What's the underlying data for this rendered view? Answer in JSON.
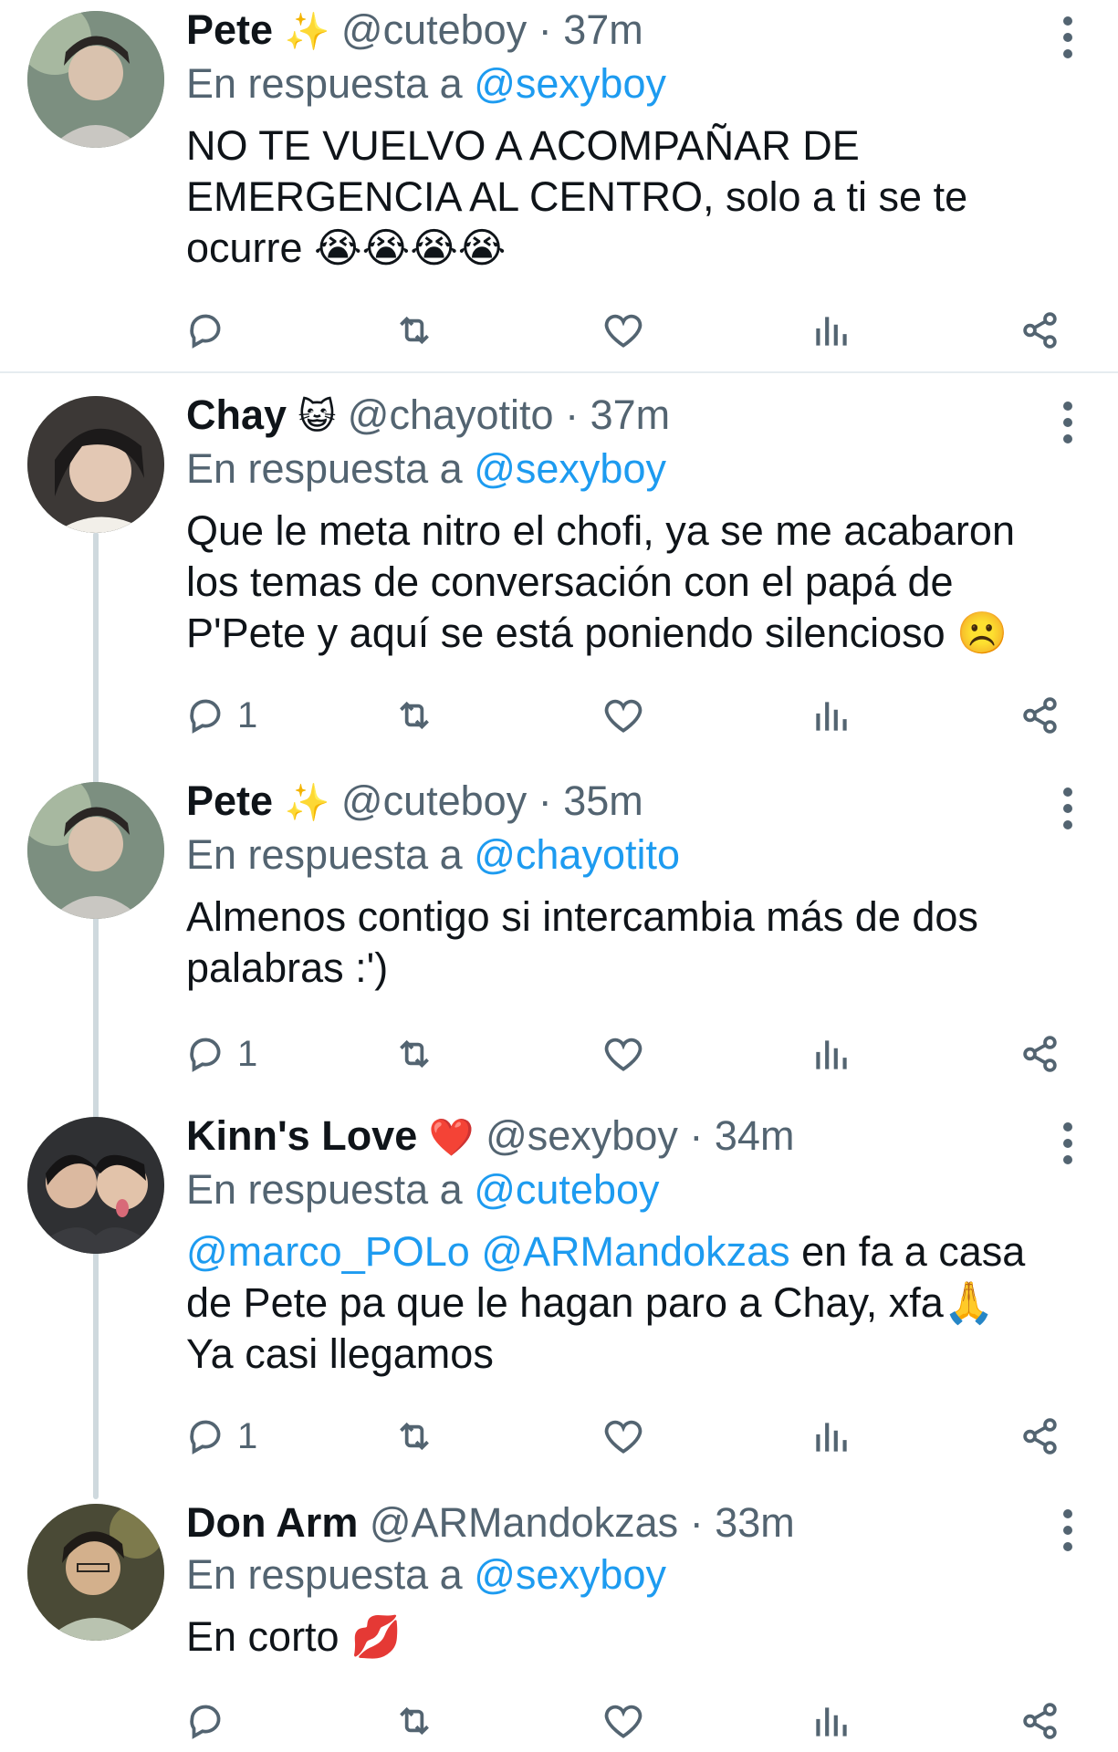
{
  "tweets": [
    {
      "name": "Pete",
      "name_emoji": "✨",
      "handle": "@cuteboy",
      "separator": "·",
      "time": "37m",
      "replying_prefix": "En respuesta a",
      "replying_to": "@sexyboy",
      "text_lines": [
        "NO TE VUELVO A ACOMPAÑAR DE",
        "EMERGENCIA AL CENTRO, solo a ti se te",
        "ocurre 😭😭😭😭"
      ],
      "reply_count": ""
    },
    {
      "name": "Chay",
      "name_emoji": "😺",
      "handle": "@chayotito",
      "separator": "·",
      "time": "37m",
      "replying_prefix": "En respuesta a",
      "replying_to": "@sexyboy",
      "text_lines": [
        "Que le meta nitro el chofi, ya se me acabaron",
        "los temas de conversación con el papá de",
        "P'Pete y aquí se está poniendo silencioso ☹️"
      ],
      "reply_count": "1"
    },
    {
      "name": "Pete",
      "name_emoji": "✨",
      "handle": "@cuteboy",
      "separator": "·",
      "time": "35m",
      "replying_prefix": "En respuesta a",
      "replying_to": "@chayotito",
      "text_lines": [
        "Almenos contigo si intercambia más de dos",
        "palabras :')"
      ],
      "reply_count": "1"
    },
    {
      "name": "Kinn's Love",
      "name_emoji": "❤️",
      "handle": "@sexyboy",
      "separator": "·",
      "time": "34m",
      "replying_prefix": "En respuesta a",
      "replying_to": "@cuteboy",
      "mention_1": "@marco_POLo",
      "mention_2": "@ARMandokzas",
      "text_line_1_rest": " en fa a casa",
      "text_lines_rest": [
        "de Pete pa que le hagan paro a Chay, xfa🙏",
        "Ya casi llegamos"
      ],
      "reply_count": "1"
    },
    {
      "name": "Don Arm",
      "name_emoji": "",
      "handle": "@ARMandokzas",
      "separator": "·",
      "time": "33m",
      "replying_prefix": "En respuesta a",
      "replying_to": "@sexyboy",
      "text_lines": [
        "En corto 💋"
      ],
      "reply_count": ""
    }
  ],
  "icons": {
    "reply": "reply-icon",
    "retweet": "retweet-icon",
    "like": "heart-icon",
    "views": "analytics-icon",
    "share": "share-icon",
    "more": "more-vertical-icon"
  },
  "colors": {
    "link": "#1d9bf0",
    "secondary_text": "#536471",
    "thread_line": "#cfd9de"
  }
}
